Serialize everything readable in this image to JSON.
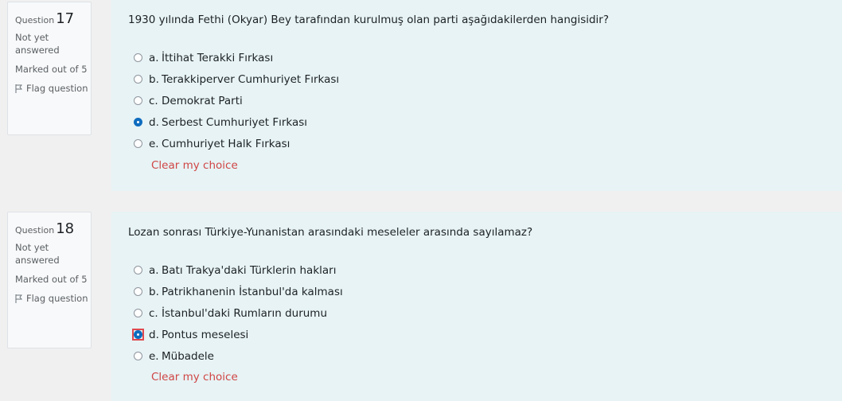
{
  "questions": [
    {
      "label": "Question",
      "number": "17",
      "state": "Not yet answered",
      "grade": "Marked out of 5",
      "flag": "Flag question",
      "text": "1930 yılında Fethi (Okyar) Bey tarafından kurulmuş olan parti aşağıdakilerden hangisidir?",
      "answers": [
        {
          "letter": "a.",
          "text": "İttihat Terakki Fırkası",
          "checked": false
        },
        {
          "letter": "b.",
          "text": "Terakkiperver Cumhuriyet Fırkası",
          "checked": false
        },
        {
          "letter": "c.",
          "text": "Demokrat Parti",
          "checked": false
        },
        {
          "letter": "d.",
          "text": "Serbest Cumhuriyet Fırkası",
          "checked": true
        },
        {
          "letter": "e.",
          "text": "Cumhuriyet Halk Fırkası",
          "checked": false
        }
      ],
      "clear": "Clear my choice"
    },
    {
      "label": "Question",
      "number": "18",
      "state": "Not yet answered",
      "grade": "Marked out of 5",
      "flag": "Flag question",
      "text": "Lozan sonrası Türkiye-Yunanistan arasındaki meseleler arasında sayılamaz?",
      "answers": [
        {
          "letter": "a.",
          "text": "Batı Trakya'daki Türklerin hakları",
          "checked": false
        },
        {
          "letter": "b.",
          "text": "Patrikhanenin İstanbul'da kalması",
          "checked": false
        },
        {
          "letter": "c.",
          "text": "İstanbul'daki Rumların durumu",
          "checked": false
        },
        {
          "letter": "d.",
          "text": "Pontus meselesi",
          "checked": true
        },
        {
          "letter": "e.",
          "text": "Mübadele",
          "checked": false
        }
      ],
      "clear": "Clear my choice"
    }
  ],
  "colors": {
    "accent": "#0f6cbf",
    "clear_link": "#d04545",
    "content_bg": "#e7f3f5",
    "focus_outline": "#e0494f"
  }
}
